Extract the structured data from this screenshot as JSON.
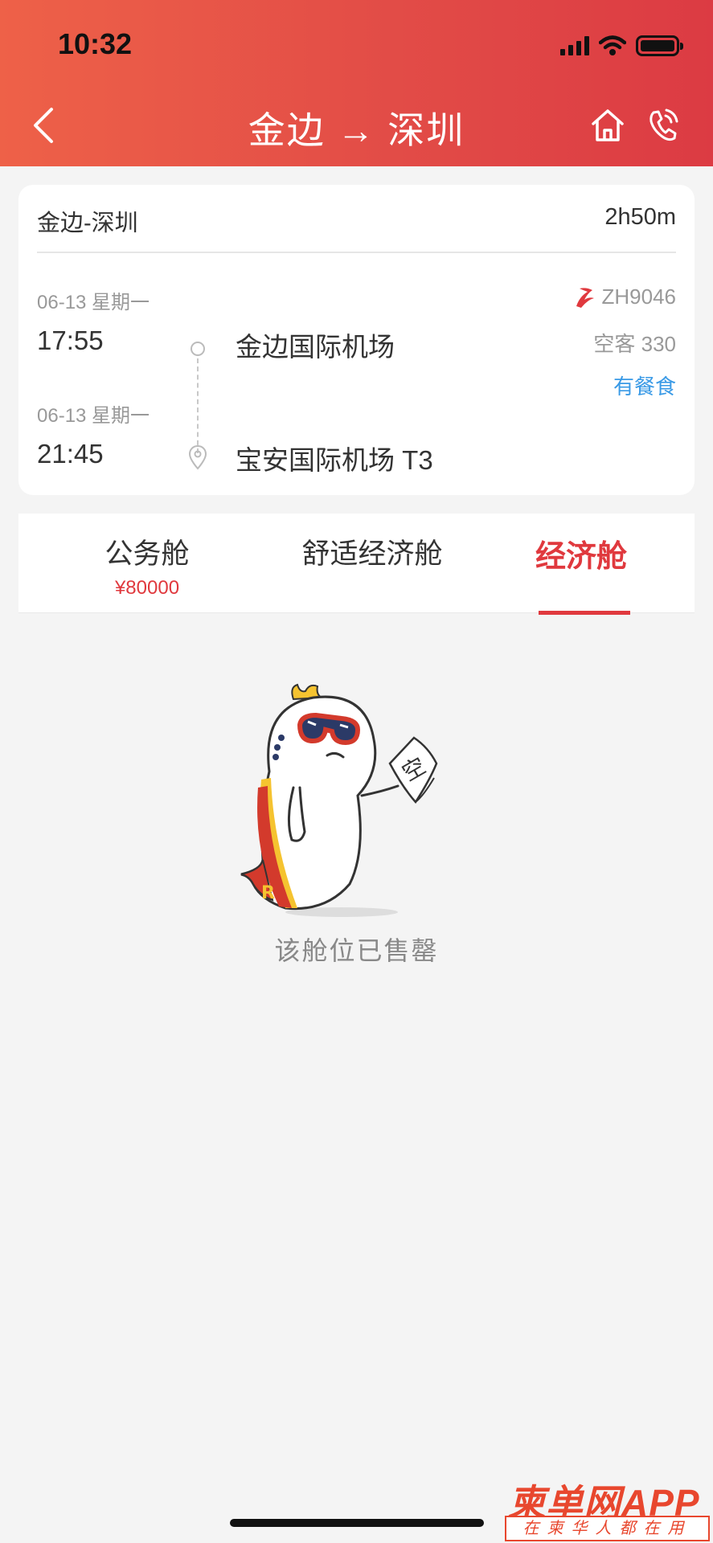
{
  "status_bar": {
    "time": "10:32"
  },
  "nav": {
    "title": "金边 → 深圳"
  },
  "flight": {
    "route": "金边-深圳",
    "duration": "2h50m",
    "departure": {
      "date": "06-13 星期一",
      "time": "17:55",
      "airport": "金边国际机场"
    },
    "arrival": {
      "date": "06-13 星期一",
      "time": "21:45",
      "airport": "宝安国际机场 T3"
    },
    "flight_number": "ZH9046",
    "aircraft": "空客 330",
    "meal": "有餐食"
  },
  "tabs": [
    {
      "label": "公务舱",
      "price": "¥80000"
    },
    {
      "label": "舒适经济舱",
      "price": ""
    },
    {
      "label": "经济舱",
      "price": ""
    }
  ],
  "active_tab": "经济舱",
  "empty_state": {
    "message": "该舱位已售罄",
    "sign_text": "空"
  },
  "watermark": {
    "title": "柬单网APP",
    "subtitle": "在柬华人都在用"
  },
  "colors": {
    "accent": "#e0393e",
    "header_start": "#ee6148",
    "header_end": "#dc3b43",
    "link": "#3a9ae6"
  },
  "icons": [
    "back-arrow-icon",
    "home-icon",
    "phone-icon",
    "location-pin-icon",
    "airline-logo-icon",
    "signal-icon",
    "wifi-icon",
    "battery-icon"
  ]
}
